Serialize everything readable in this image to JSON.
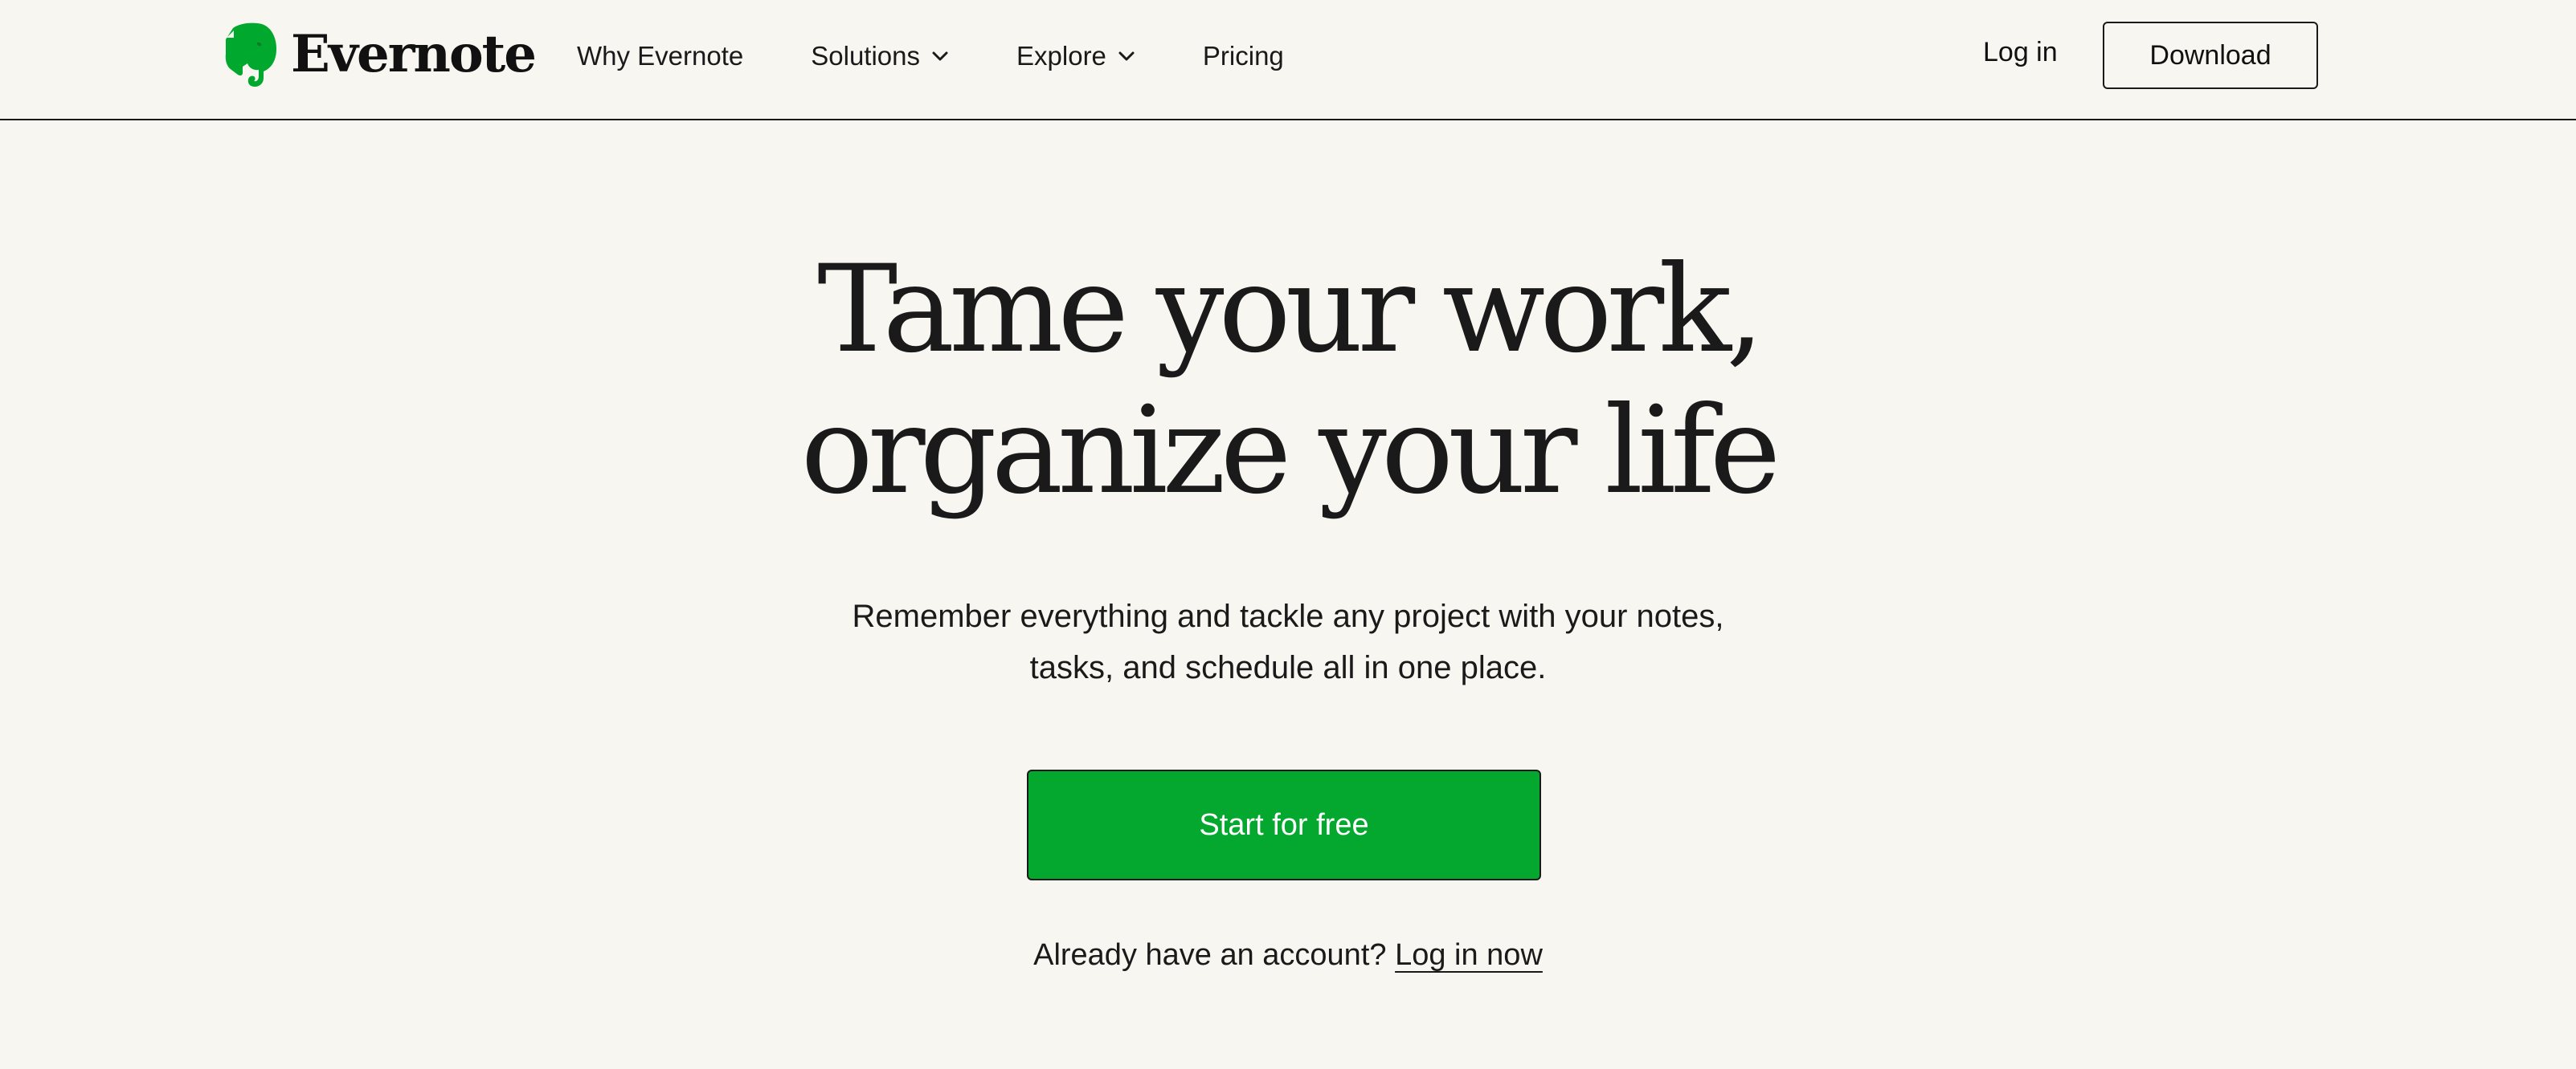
{
  "brand": {
    "name": "Evernote",
    "logo_icon": "elephant-icon",
    "accent_color": "#00a82d"
  },
  "nav": {
    "items": [
      {
        "label": "Why Evernote",
        "has_dropdown": false
      },
      {
        "label": "Solutions",
        "has_dropdown": true
      },
      {
        "label": "Explore",
        "has_dropdown": true
      },
      {
        "label": "Pricing",
        "has_dropdown": false
      }
    ],
    "dropdown_icon": "chevron-down-icon"
  },
  "header_actions": {
    "login_label": "Log in",
    "download_label": "Download"
  },
  "hero": {
    "title_line1": "Tame your work,",
    "title_line2": "organize your life",
    "subtitle_line1": "Remember everything and tackle any project with your notes,",
    "subtitle_line2": "tasks, and schedule all in one place.",
    "cta_label": "Start for free",
    "account_prompt": "Already have an account?",
    "account_link": "Log in now"
  },
  "colors": {
    "background": "#f8f6f1",
    "cta_green": "#04a82e",
    "text": "#1a1a1a"
  }
}
